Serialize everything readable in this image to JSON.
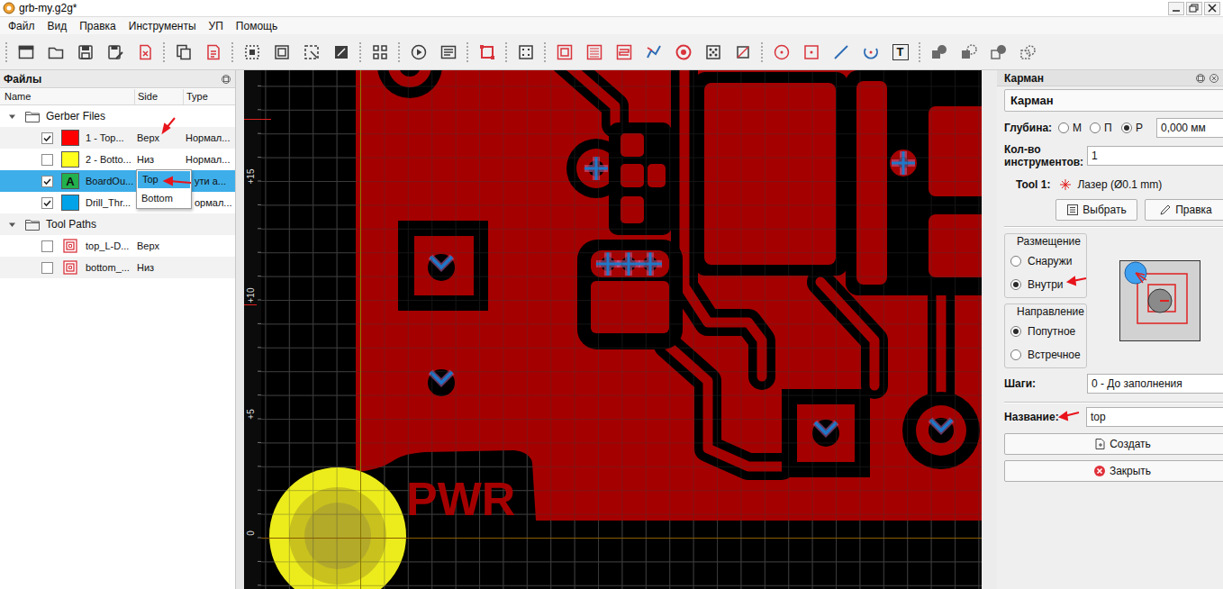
{
  "window": {
    "title": "grb-my.g2g*"
  },
  "menu": [
    "Файл",
    "Вид",
    "Правка",
    "Инструменты",
    "УП",
    "Помощь"
  ],
  "toolbar": {
    "text_tool_label": "T"
  },
  "files_panel": {
    "title": "Файлы",
    "columns": [
      "Name",
      "Side",
      "Type"
    ],
    "groups": [
      {
        "label": "Gerber Files",
        "expanded": true,
        "items": [
          {
            "name": "1 - Top...",
            "side": "Верх",
            "type": "Нормал...",
            "checked": true,
            "color": "#ff0000",
            "kind": "layer",
            "selected": false
          },
          {
            "name": "2 - Botto...",
            "side": "Низ",
            "type": "Нормал...",
            "checked": false,
            "color": "#ffff1e",
            "kind": "layer",
            "selected": false
          },
          {
            "name": "BoardOu...",
            "type": "ути а...",
            "checked": true,
            "color": "#22b14c",
            "kind": "outline",
            "icon_letter": "A",
            "selected": true
          },
          {
            "name": "Drill_Thr...",
            "type": "ормал...",
            "checked": true,
            "color": "#00a2e8",
            "kind": "layer",
            "selected": false
          }
        ]
      },
      {
        "label": "Tool Paths",
        "expanded": true,
        "items": [
          {
            "name": "top_L-D...",
            "side": "Верх",
            "checked": false,
            "kind": "toolpath",
            "selected": false
          },
          {
            "name": "bottom_...",
            "side": "Низ",
            "checked": false,
            "kind": "toolpath",
            "selected": false
          }
        ]
      }
    ],
    "side_dropdown": {
      "options": [
        {
          "label": "Top",
          "selected": true
        },
        {
          "label": "Bottom",
          "selected": false
        }
      ]
    }
  },
  "canvas": {
    "ruler_labels": [
      "+15",
      "+10",
      "+5",
      "0"
    ],
    "board_label": "PWR"
  },
  "pocket_panel": {
    "dock_title": "Карман",
    "mode": "Карман",
    "depth": {
      "label": "Глубина:",
      "options": [
        {
          "label": "М",
          "selected": false
        },
        {
          "label": "П",
          "selected": false
        },
        {
          "label": "Р",
          "selected": true
        }
      ],
      "value": "0,000 мм"
    },
    "tool_count": {
      "label": "Кол-во инструментов:",
      "value": "1"
    },
    "tools": [
      {
        "label": "Tool 1:",
        "name": "Лазер (Ø0.1 mm)"
      }
    ],
    "tool_buttons": [
      "Выбрать",
      "Правка"
    ],
    "placement": {
      "title": "Размещение",
      "options": [
        {
          "label": "Снаружи",
          "selected": false
        },
        {
          "label": "Внутри",
          "selected": true
        }
      ]
    },
    "direction": {
      "title": "Направление",
      "options": [
        {
          "label": "Попутное",
          "selected": true
        },
        {
          "label": "Встречное",
          "selected": false
        }
      ]
    },
    "steps": {
      "label": "Шаги:",
      "value": "0 - До заполнения"
    },
    "name_field": {
      "label": "Название:",
      "value": "top"
    },
    "actions": [
      "Создать",
      "Закрыть"
    ]
  }
}
